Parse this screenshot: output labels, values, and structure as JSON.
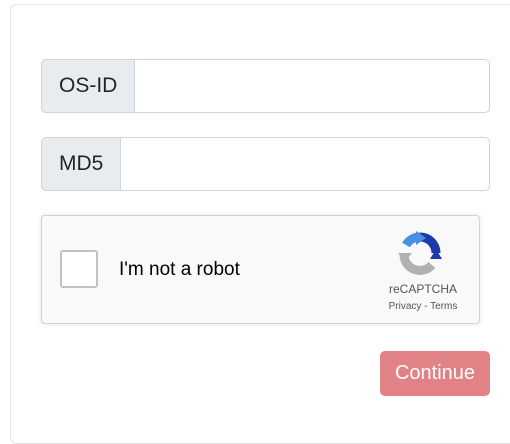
{
  "form": {
    "osid": {
      "label": "OS-ID",
      "value": "",
      "placeholder": ""
    },
    "md5": {
      "label": "MD5",
      "value": "",
      "placeholder": ""
    }
  },
  "recaptcha": {
    "checkbox_label": "I'm not a robot",
    "brand": "reCAPTCHA",
    "privacy_link": "Privacy",
    "separator": " - ",
    "terms_link": "Terms",
    "logo_icon": "recaptcha-logo-icon"
  },
  "actions": {
    "continue_label": "Continue"
  },
  "colors": {
    "continue_button": "#e08286",
    "recaptcha_blue": "#1c3aa9",
    "recaptcha_lightblue": "#4a90e2",
    "recaptcha_gray": "#b1b1b1"
  }
}
